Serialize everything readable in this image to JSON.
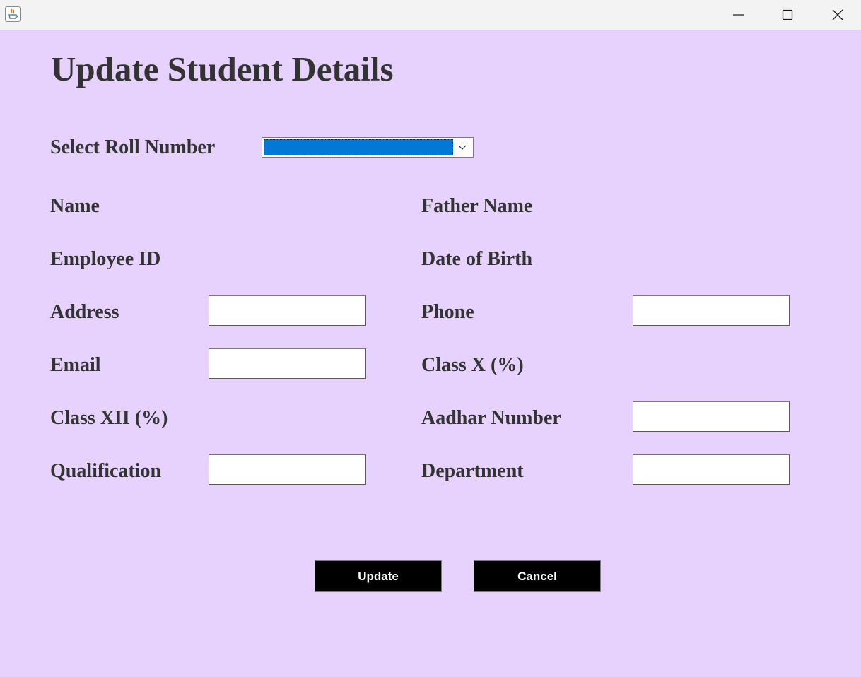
{
  "window": {
    "title": "",
    "app_icon": "java-cup-icon",
    "controls": {
      "minimize_icon": "minimize-icon",
      "maximize_icon": "maximize-icon",
      "close_icon": "close-icon"
    }
  },
  "colors": {
    "background": "#e6d2fc",
    "titlebar": "#f3f3f3",
    "text": "#333333",
    "button_bg": "#000000",
    "button_text": "#ffffff",
    "combo_selection": "#0078d7"
  },
  "form": {
    "heading": "Update Student Details",
    "roll_number": {
      "label": "Select Roll Number",
      "selected_value": ""
    },
    "fields": {
      "name": {
        "label": "Name"
      },
      "father_name": {
        "label": "Father Name"
      },
      "employee_id": {
        "label": "Employee ID"
      },
      "dob": {
        "label": "Date of Birth"
      },
      "address": {
        "label": "Address",
        "value": ""
      },
      "phone": {
        "label": "Phone",
        "value": ""
      },
      "email": {
        "label": "Email",
        "value": ""
      },
      "class_x": {
        "label": "Class X (%)"
      },
      "class_xii": {
        "label": "Class XII (%)"
      },
      "aadhar": {
        "label": "Aadhar Number",
        "value": ""
      },
      "qualification": {
        "label": "Qualification",
        "value": ""
      },
      "department": {
        "label": "Department",
        "value": ""
      }
    },
    "buttons": {
      "update": "Update",
      "cancel": "Cancel"
    }
  }
}
